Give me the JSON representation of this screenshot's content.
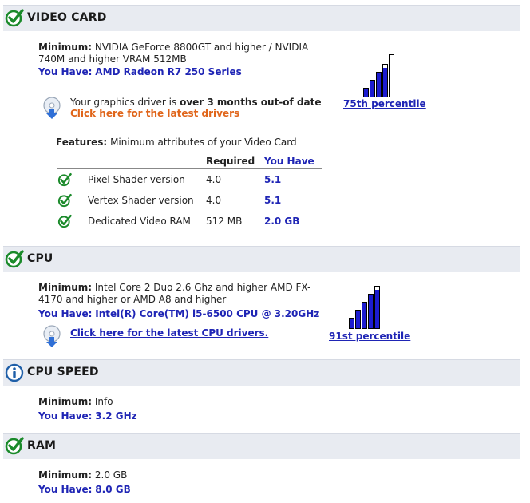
{
  "labels": {
    "minimum": "Minimum:",
    "you_have": "You Have:",
    "features": "Features:",
    "col_required": "Required",
    "col_you_have": "You Have"
  },
  "video_card": {
    "title": "VIDEO CARD",
    "minimum_line1": "NVIDIA GeForce 8800GT and higher / NVIDIA",
    "minimum_line2": "740M and higher VRAM 512MB",
    "you_have": "AMD Radeon R7 250 Series",
    "driver_text_pre": "Your graphics driver is ",
    "driver_text_bold": "over 3 months out-of date",
    "driver_link": "Click here for the latest drivers",
    "percentile": "75th percentile",
    "percentile_level": 0.75,
    "features_desc": "Minimum attributes of your Video Card",
    "features": [
      {
        "name": "Pixel Shader version",
        "required": "4.0",
        "you_have": "5.1"
      },
      {
        "name": "Vertex Shader version",
        "required": "4.0",
        "you_have": "5.1"
      },
      {
        "name": "Dedicated Video RAM",
        "required": "512 MB",
        "you_have": "2.0 GB"
      }
    ]
  },
  "cpu": {
    "title": "CPU",
    "minimum_line1": "Intel Core 2 Duo 2.6 Ghz and higher AMD FX-",
    "minimum_line2": "4170 and higher or AMD A8 and higher",
    "you_have": "Intel(R) Core(TM) i5-6500 CPU @ 3.20GHz",
    "driver_link": "Click here for the latest CPU drivers.",
    "percentile": "91st percentile",
    "percentile_level": 0.91
  },
  "cpu_speed": {
    "title": "CPU SPEED",
    "minimum": "Info",
    "you_have": "3.2 GHz"
  },
  "ram": {
    "title": "RAM",
    "minimum": "2.0 GB",
    "you_have": "8.0 GB"
  },
  "colors": {
    "pass_green": "#1a8a2a",
    "info_blue": "#1f5fa8",
    "bar_blue": "#1c1cd0",
    "link_blue": "#1f25b5",
    "warn_orange": "#e0651a",
    "header_bg": "#e8ebf1"
  },
  "icons": {
    "pass": "check-circle-icon",
    "info": "info-circle-icon",
    "driver": "download-disc-icon"
  }
}
